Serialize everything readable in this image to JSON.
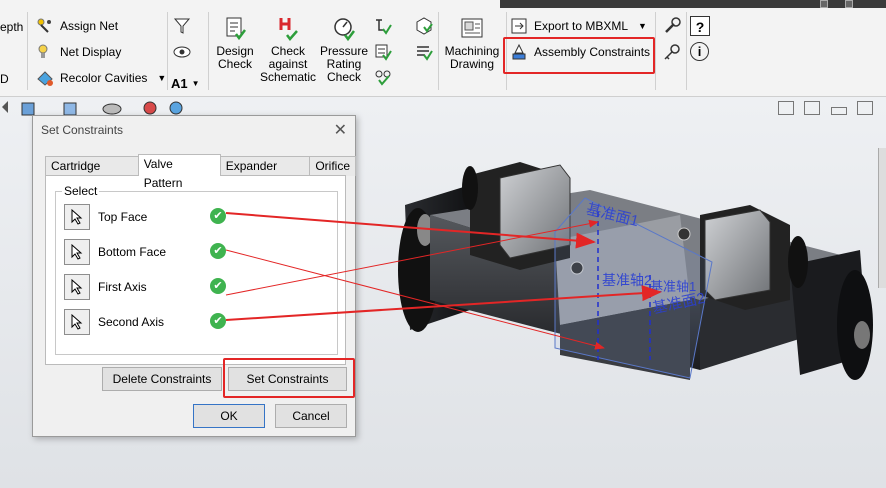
{
  "ribbon": {
    "left_items": [
      "epth",
      "D"
    ],
    "assign_net": "Assign Net",
    "net_display": "Net Display",
    "recolor_cavities": "Recolor Cavities",
    "a1": "A1",
    "design_check": "Design Check",
    "check_against_schematic": "Check against Schematic",
    "pressure_rating_check": "Pressure Rating Check",
    "machining_drawing": "Machining Drawing",
    "export_mbxml": "Export to MBXML",
    "assembly_constraints": "Assembly Constraints"
  },
  "dialog": {
    "title": "Set Constraints",
    "tabs": [
      "Cartridge Valve",
      "Valve Pattern",
      "Expander Plug",
      "Orifice"
    ],
    "active_tab": "Valve Pattern",
    "group_label": "Select",
    "rows": [
      {
        "label": "Top Face",
        "status": "ok"
      },
      {
        "label": "Bottom Face",
        "status": "ok"
      },
      {
        "label": "First Axis",
        "status": "ok"
      },
      {
        "label": "Second Axis",
        "status": "ok"
      }
    ],
    "delete_button": "Delete Constraints",
    "set_button": "Set Constraints",
    "ok_button": "OK",
    "cancel_button": "Cancel"
  },
  "model_labels": {
    "face1": "基准面1",
    "face2": "基准面2",
    "axis2": "基准轴2",
    "axis1": "基准轴1"
  },
  "colors": {
    "highlight": "#e32626",
    "check": "#3fb34f",
    "annotation": "#2a3fd4"
  }
}
